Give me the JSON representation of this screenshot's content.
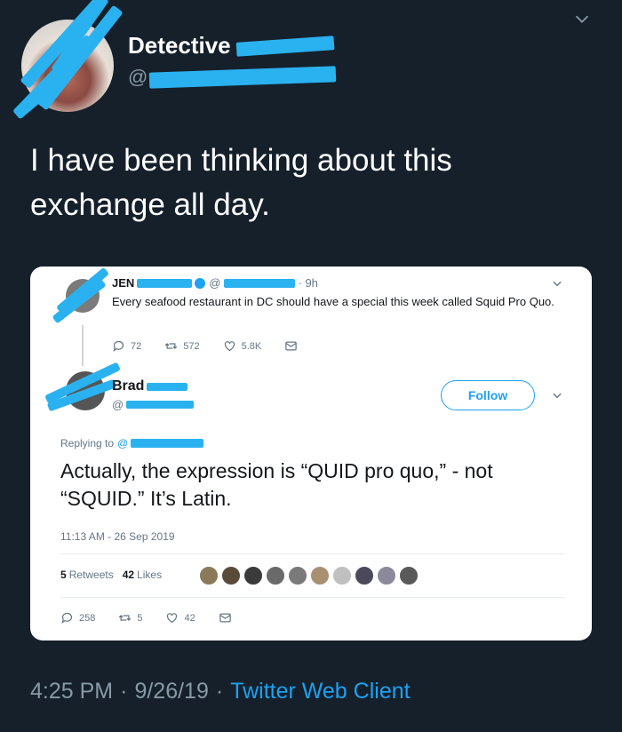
{
  "outer_tweet": {
    "display_name": "Detective",
    "handle_prefix": "@",
    "text": "I have been thinking about this exchange all day.",
    "timestamp": "4:25 PM",
    "date": "9/26/19",
    "separator": "·",
    "client": "Twitter Web Client"
  },
  "embedded": {
    "tweet1": {
      "name": "JEN",
      "at": "@",
      "time": "· 9h",
      "text": "Every seafood restaurant in DC should have a special this week called Squid Pro Quo.",
      "replies": "72",
      "retweets": "572",
      "likes": "5.8K"
    },
    "tweet2": {
      "name": "Brad",
      "handle": "@",
      "follow_label": "Follow",
      "replying_to": "Replying to",
      "replying_at": "@",
      "text": "Actually, the expression is “QUID pro quo,” - not “SQUID.” It’s Latin.",
      "timestamp": "11:13 AM - 26 Sep 2019",
      "retweets_count": "5",
      "retweets_label": "Retweets",
      "likes_count": "42",
      "likes_label": "Likes",
      "replies": "258",
      "retweets": "5",
      "likes": "42"
    }
  },
  "colors": {
    "background": "#15202b",
    "accent": "#1da1f2",
    "redaction": "#2ab1f0",
    "muted": "#8899a6"
  },
  "icons": [
    "chevron-down-icon",
    "reply-icon",
    "retweet-icon",
    "like-icon",
    "message-icon",
    "verified-icon"
  ]
}
